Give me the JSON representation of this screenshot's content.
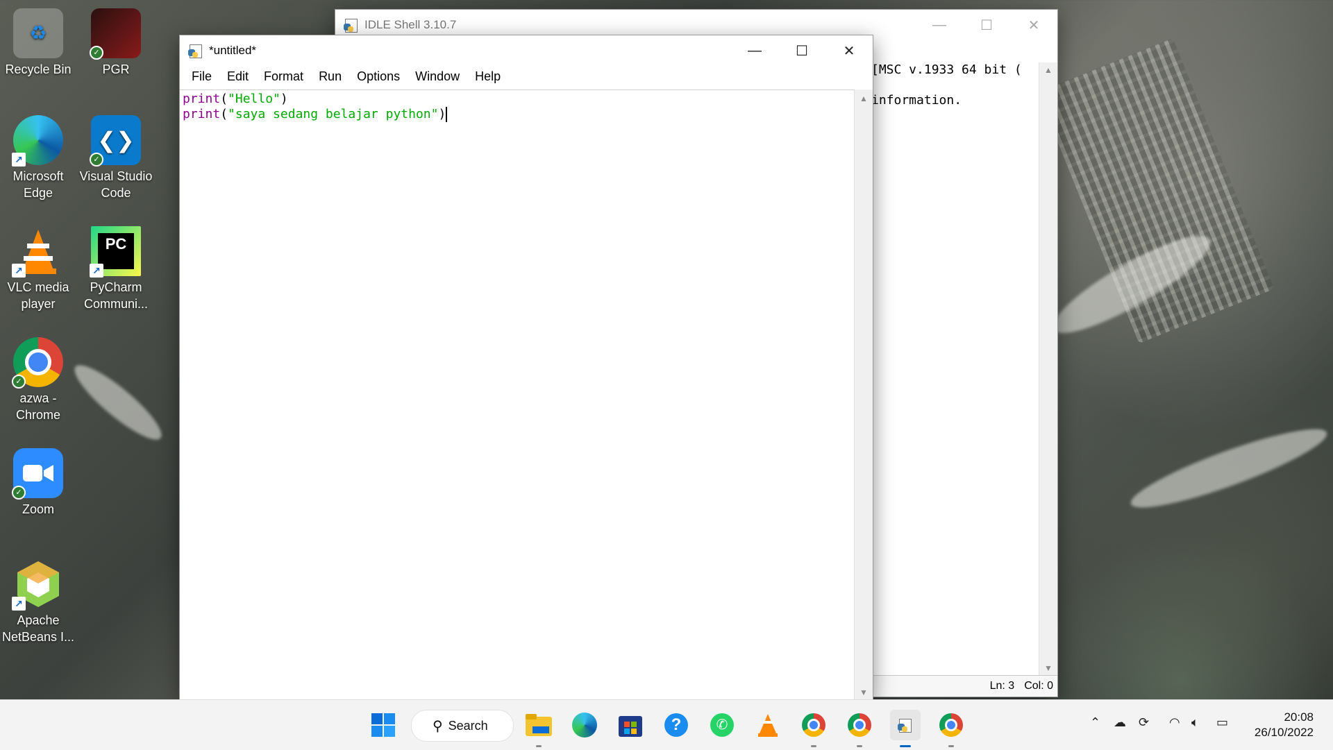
{
  "desktop": {
    "icons": [
      {
        "label": "Recycle Bin",
        "icon": "recycle-bin-icon"
      },
      {
        "label": "PGR",
        "icon": "pgr-icon"
      },
      {
        "label": "Microsoft Edge",
        "icon": "edge-icon"
      },
      {
        "label": "Visual Studio Code",
        "icon": "vscode-icon"
      },
      {
        "label": "VLC media player",
        "icon": "vlc-icon"
      },
      {
        "label": "PyCharm Communi...",
        "icon": "pycharm-icon"
      },
      {
        "label": "azwa - Chrome",
        "icon": "chrome-profile-icon"
      },
      {
        "label": "Zoom",
        "icon": "zoom-icon"
      },
      {
        "label": "Apache NetBeans I...",
        "icon": "netbeans-icon"
      }
    ]
  },
  "shell_window": {
    "title": "IDLE Shell 3.10.7",
    "line1": "[MSC v.1933 64 bit (",
    "line2": "information.",
    "status": {
      "ln": "Ln: 3",
      "col": "Col: 0"
    }
  },
  "editor_window": {
    "title": "*untitled*",
    "menu": [
      "File",
      "Edit",
      "Format",
      "Run",
      "Options",
      "Window",
      "Help"
    ],
    "code": [
      {
        "fn": "print",
        "open": "(",
        "str": "\"Hello\"",
        "close": ")"
      },
      {
        "fn": "print",
        "open": "(",
        "str": "\"saya sedang belajar python\"",
        "close": ")"
      }
    ]
  },
  "taskbar": {
    "search_label": "Search",
    "apps": [
      "start-icon",
      "file-explorer-icon",
      "edge-icon",
      "microsoft-store-icon",
      "help-icon",
      "whatsapp-icon",
      "vlc-icon",
      "chrome-profile-icon",
      "chrome-profile-icon",
      "idle-python-icon",
      "chrome-icon"
    ],
    "time": "20:08",
    "date": "26/10/2022"
  },
  "colors": {
    "keyword": "#900090",
    "string": "#00aa00",
    "accent": "#0067c0"
  }
}
